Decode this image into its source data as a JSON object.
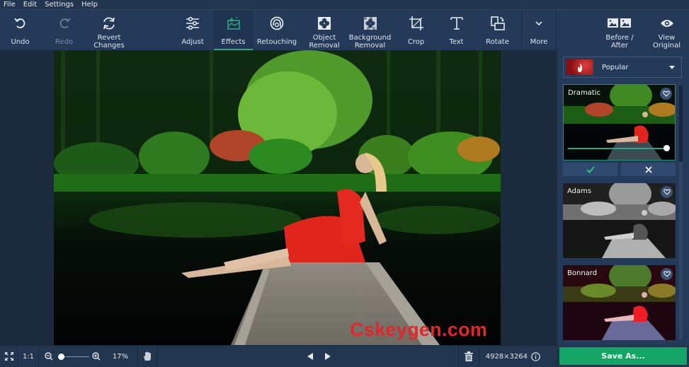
{
  "menu": [
    "File",
    "Edit",
    "Settings",
    "Help"
  ],
  "toolbar": {
    "undo": "Undo",
    "redo": "Redo",
    "revert": [
      "Revert",
      "Changes"
    ],
    "adjust": "Adjust",
    "effects": "Effects",
    "retouching": "Retouching",
    "object_removal": [
      "Object",
      "Removal"
    ],
    "background_removal": [
      "Background",
      "Removal"
    ],
    "crop": "Crop",
    "text": "Text",
    "rotate": "Rotate",
    "more": "More",
    "before_after": [
      "Before /",
      "After"
    ],
    "view_original": [
      "View",
      "Original"
    ],
    "active_tab": "Effects"
  },
  "sidebar": {
    "category": "Popular",
    "effects": [
      {
        "name": "Dramatic",
        "selected": true,
        "intensity": 1.0
      },
      {
        "name": "Adams",
        "selected": false
      },
      {
        "name": "Bonnard",
        "selected": false
      }
    ],
    "apply_icon": "check-icon",
    "cancel_icon": "close-icon"
  },
  "status": {
    "fit_label": "1:1",
    "zoom_percent": "17%",
    "zoom_level": 0.05,
    "dimensions": "4928×3264"
  },
  "save_label": "Save As...",
  "watermark": "Cskeygen.com",
  "colors": {
    "accent": "#2ea87a",
    "save": "#14a466",
    "toolbar": "#243a58"
  }
}
